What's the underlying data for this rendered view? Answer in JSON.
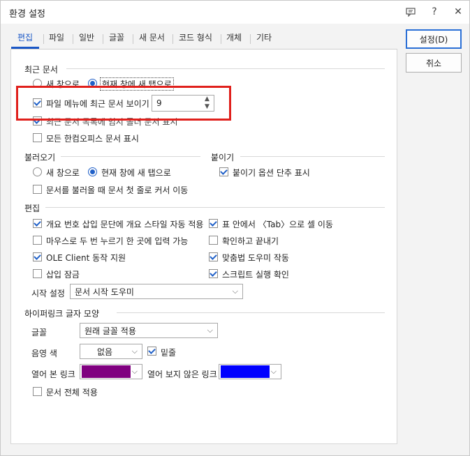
{
  "window": {
    "title": "환경 설정",
    "icons": [
      "comment-icon",
      "help-icon",
      "close-icon"
    ],
    "help_glyph": "?",
    "close_glyph": "✕"
  },
  "tabs": [
    "편집",
    "파일",
    "일반",
    "글꼴",
    "새 문서",
    "코드 형식",
    "개체",
    "기타"
  ],
  "buttons": {
    "ok": "설정(D)",
    "cancel": "취소"
  },
  "recent": {
    "section": "최근 문서",
    "open_new_window": "새 창으로",
    "open_new_tab": "현재 창에 새 탭으로",
    "show_in_file_menu": "파일 메뉴에 최근 문서 보이기",
    "count": "9",
    "hidden_option": "최근 문서 목록에 임시 폴더 문서 표시",
    "show_all_hancom": "모든 한컴오피스 문서 표시"
  },
  "load": {
    "section": "불러오기",
    "new_window": "새 창으로",
    "new_tab": "현재 창에 새 탭으로",
    "cursor_first_line": "문서를 불러올 때 문서 첫 줄로 커서 이동"
  },
  "paste": {
    "section": "붙이기",
    "option_shortcut": "붙이기 옵션 단추 표시"
  },
  "edit": {
    "section": "편집",
    "left": [
      "개요 번호 삽입 문단에 개요 스타일 자동 적용",
      "마우스로 두 번 누르기 한 곳에 입력 가능",
      "OLE Client 동작 지원",
      "삽입 잠금"
    ],
    "left_checked": [
      true,
      false,
      true,
      false
    ],
    "right": [
      "표 안에서 〈Tab〉으로 셀 이동",
      "확인하고 끝내기",
      "맞춤법 도우미 작동",
      "스크립트 실행 확인"
    ],
    "right_checked": [
      true,
      false,
      true,
      true
    ],
    "start_label": "시작 설정",
    "start_value": "문서 시작 도우미"
  },
  "hyperlink": {
    "section": "하이퍼링크 글자 모양",
    "font_label": "글꼴",
    "font_value": "원래 글꼴 적용",
    "shade_label": "음영 색",
    "shade_value": "없음",
    "underline": "밑줄",
    "visited_label": "열어 본 링크",
    "visited_color": "#800080",
    "unvisited_label": "열어 보지 않은 링크",
    "unvisited_color": "#0000ff",
    "apply_all": "문서 전체 적용"
  },
  "colors": {
    "accent": "#1a57c6",
    "highlight": "#e0201c"
  }
}
